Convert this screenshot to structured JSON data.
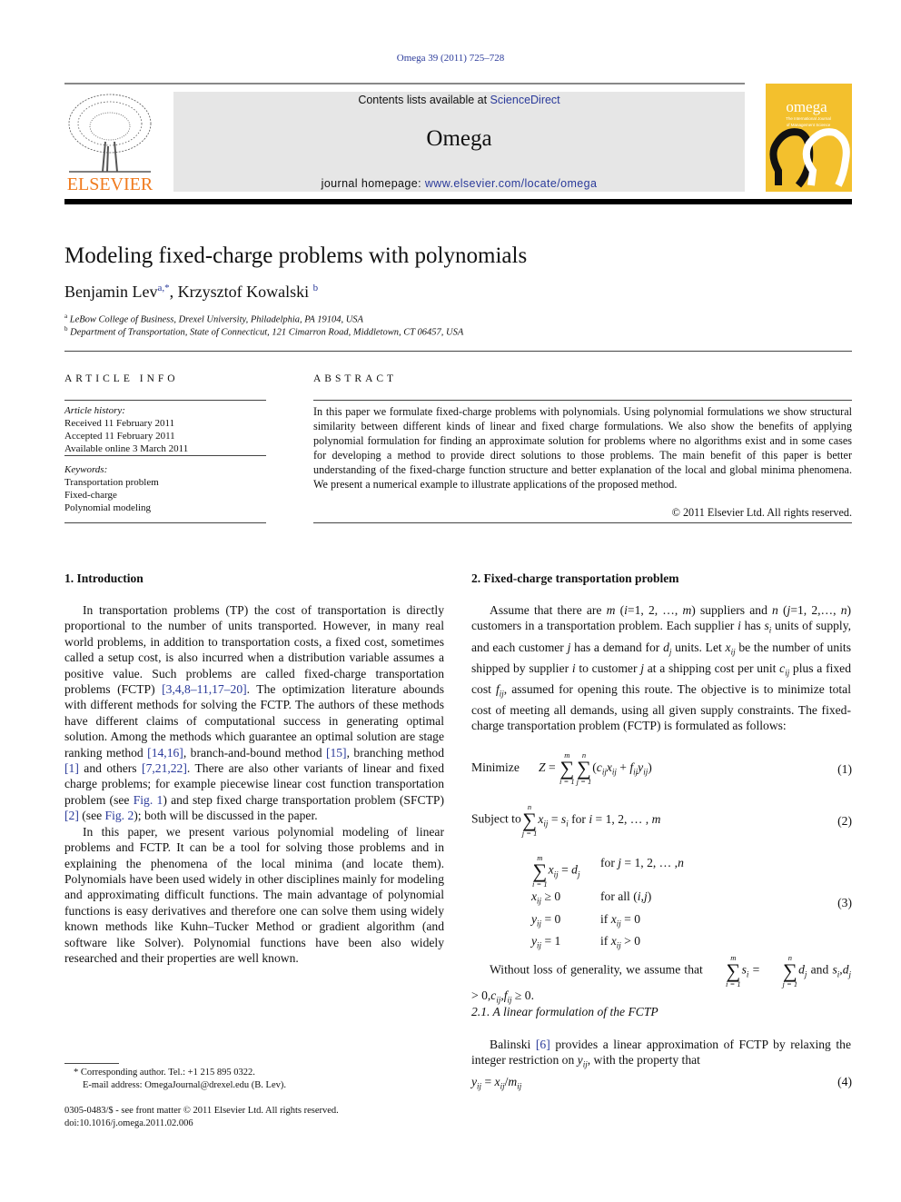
{
  "header": {
    "citation": "Omega 39 (2011) 725–728",
    "contents_prefix": "Contents lists available at ",
    "contents_link": "ScienceDirect",
    "journal": "Omega",
    "homepage_prefix": "journal homepage: ",
    "homepage_link": "www.elsevier.com/locate/omega",
    "publisher_logo": "ELSEVIER",
    "cover_title": "omega",
    "cover_subtitle": "The International Journal of Management Science",
    "colors": {
      "publisher": "#f07b1f",
      "cover": "#f3c02d",
      "link": "#2a3a9a"
    }
  },
  "article": {
    "title": "Modeling fixed-charge problems with polynomials",
    "authors": [
      {
        "name": "Benjamin Lev",
        "sup": "a,*"
      },
      {
        "name": "Krzysztof Kowalski",
        "sup": "b"
      }
    ],
    "affiliations": [
      {
        "sup": "a",
        "text": "LeBow College of Business, Drexel University, Philadelphia, PA 19104, USA"
      },
      {
        "sup": "b",
        "text": "Department of Transportation, State of Connecticut, 121 Cimarron Road, Middletown, CT 06457, USA"
      }
    ]
  },
  "info": {
    "heading": "ARTICLE INFO",
    "history_label": "Article history:",
    "history": [
      "Received 11 February 2011",
      "Accepted 11 February 2011",
      "Available online 3 March 2011"
    ],
    "keywords_label": "Keywords:",
    "keywords": [
      "Transportation problem",
      "Fixed-charge",
      "Polynomial modeling"
    ]
  },
  "abstract": {
    "heading": "ABSTRACT",
    "text": "In this paper we formulate fixed-charge problems with polynomials. Using polynomial formulations we show structural similarity between different kinds of linear and fixed charge formulations. We also show the benefits of applying polynomial formulation for finding an approximate solution for problems where no algorithms exist and in some cases for developing a method to provide direct solutions to those problems. The main benefit of this paper is better understanding of the fixed-charge function structure and better explanation of the local and global minima phenomena. We present a numerical example to illustrate applications of the proposed method.",
    "copyright": "© 2011 Elsevier Ltd. All rights reserved."
  },
  "left": {
    "heading": "1.  Introduction",
    "paragraphs": [
      [
        [
          "t",
          "In transportation problems (TP) the cost of transportation is directly proportional to the number of units transported. However, in many real world problems, in addition to transportation costs, a fixed cost, sometimes called a setup cost, is also incurred when a distribution variable assumes a positive value. Such problems are called fixed-charge transportation problems (FCTP) "
        ],
        [
          "l",
          "[3,4,8–11,17–20]"
        ],
        [
          "t",
          ". The optimization literature abounds with different methods for solving the FCTP. The authors of these methods have different claims of computational success in generating optimal solution. Among the methods which guarantee an optimal solution are stage ranking method "
        ],
        [
          "l",
          "[14,16]"
        ],
        [
          "t",
          ", branch-and-bound method "
        ],
        [
          "l",
          "[15]"
        ],
        [
          "t",
          ", branching method "
        ],
        [
          "l",
          "[1]"
        ],
        [
          "t",
          " and others "
        ],
        [
          "l",
          "[7,21,22]"
        ],
        [
          "t",
          ". There are also other variants of linear and fixed charge problems; for example piecewise linear cost function transportation problem (see "
        ],
        [
          "l",
          "Fig. 1"
        ],
        [
          "t",
          ") and step fixed charge transportation problem (SFCTP) "
        ],
        [
          "l",
          "[2]"
        ],
        [
          "t",
          " (see "
        ],
        [
          "l",
          "Fig. 2"
        ],
        [
          "t",
          "); both will be discussed in the paper."
        ]
      ],
      [
        [
          "t",
          "In this paper, we present various polynomial modeling of linear problems and FCTP. It can be a tool for solving those problems and in explaining the phenomena of the local minima (and locate them). Polynomials have been used widely in other disciplines mainly for modeling and approximating difficult functions. The main advantage of polynomial functions is easy derivatives and therefore one can solve them using widely known methods like Kuhn–Tucker Method or gradient algorithm (and software like Solver). Polynomial functions have been also widely researched and their properties are well known."
        ]
      ]
    ],
    "footnotes": [
      "* Corresponding author. Tel.: +1 215 895 0322.",
      "E-mail address: OmegaJournal@drexel.edu (B. Lev)."
    ],
    "front_matter": "0305-0483/$ - see front matter © 2011 Elsevier Ltd. All rights reserved.",
    "doi": "doi:10.1016/j.omega.2011.02.006"
  },
  "right": {
    "heading": "2.  Fixed-charge transportation problem",
    "p1": [
      [
        "t",
        "Assume that there are "
      ],
      [
        "i",
        "m"
      ],
      [
        "t",
        " ("
      ],
      [
        "i",
        "i"
      ],
      [
        "t",
        "=1, 2, …, "
      ],
      [
        "i",
        "m"
      ],
      [
        "t",
        ") suppliers and "
      ],
      [
        "i",
        "n"
      ],
      [
        "t",
        " ("
      ],
      [
        "i",
        "j"
      ],
      [
        "t",
        "=1, 2,…, "
      ],
      [
        "i",
        "n"
      ],
      [
        "t",
        ") customers in a transportation problem. Each supplier "
      ],
      [
        "i",
        "i"
      ],
      [
        "t",
        " has "
      ],
      [
        "i",
        "s"
      ],
      [
        "s",
        "i"
      ],
      [
        "t",
        " units of supply, and each customer "
      ],
      [
        "i",
        "j"
      ],
      [
        "t",
        " has a demand for "
      ],
      [
        "i",
        "d"
      ],
      [
        "s",
        "j"
      ],
      [
        "t",
        " units. Let "
      ],
      [
        "i",
        "x"
      ],
      [
        "s",
        "ij"
      ],
      [
        "t",
        " be the number of units shipped by supplier "
      ],
      [
        "i",
        "i"
      ],
      [
        "t",
        " to customer "
      ],
      [
        "i",
        "j"
      ],
      [
        "t",
        " at a shipping cost per unit "
      ],
      [
        "i",
        "c"
      ],
      [
        "s",
        "ij"
      ],
      [
        "t",
        " plus a fixed cost "
      ],
      [
        "i",
        "f"
      ],
      [
        "s",
        "ij"
      ],
      [
        "t",
        ", assumed for opening this route. The objective is to minimize total cost of meeting all demands, using all given supply constraints. The fixed-charge transportation problem (FCTP) is formulated as follows:"
      ]
    ],
    "eq1": {
      "label": "Minimize",
      "expr": [
        [
          "i",
          "Z"
        ],
        [
          "t",
          " = "
        ],
        [
          "sum",
          "m",
          "i = 1"
        ],
        [
          "sum",
          "n",
          "j = 1"
        ],
        [
          "t",
          "("
        ],
        [
          "i",
          "c"
        ],
        [
          "s",
          "ij"
        ],
        [
          "i",
          "x"
        ],
        [
          "s",
          "ij"
        ],
        [
          "t",
          " + "
        ],
        [
          "i",
          "f"
        ],
        [
          "s",
          "ij"
        ],
        [
          "i",
          "y"
        ],
        [
          "s",
          "ij"
        ],
        [
          "t",
          ")"
        ]
      ],
      "num": "(1)"
    },
    "eq2": {
      "label": "Subject to",
      "expr": [
        [
          "sum",
          "n",
          "j = 1"
        ],
        [
          "i",
          "x"
        ],
        [
          "s",
          "ij"
        ],
        [
          "t",
          " = "
        ],
        [
          "i",
          "s"
        ],
        [
          "s",
          "i"
        ],
        [
          "t",
          "  for "
        ],
        [
          "i",
          "i"
        ],
        [
          "t",
          " = 1, 2, … , "
        ],
        [
          "i",
          "m"
        ]
      ],
      "num": "(2)"
    },
    "eq3": {
      "rows": [
        {
          "a": [
            [
              "sum",
              "m",
              "i = 1"
            ],
            [
              "i",
              "x"
            ],
            [
              "s",
              "ij"
            ],
            [
              "t",
              " = "
            ],
            [
              "i",
              "d"
            ],
            [
              "s",
              "j"
            ]
          ],
          "b": [
            [
              "t",
              "for "
            ],
            [
              "i",
              "j"
            ],
            [
              "t",
              " = 1, 2, … ,"
            ],
            [
              "i",
              "n"
            ]
          ]
        },
        {
          "a": [
            [
              "i",
              "x"
            ],
            [
              "s",
              "ij"
            ],
            [
              "t",
              " ≥ 0"
            ]
          ],
          "b": [
            [
              "t",
              "for all ("
            ],
            [
              "i",
              "i,j"
            ],
            [
              "t",
              ")"
            ]
          ]
        },
        {
          "a": [
            [
              "i",
              "y"
            ],
            [
              "s",
              "ij"
            ],
            [
              "t",
              " = 0"
            ]
          ],
          "b": [
            [
              "t",
              "if "
            ],
            [
              "i",
              "x"
            ],
            [
              "s",
              "ij"
            ],
            [
              "t",
              " = 0"
            ]
          ]
        },
        {
          "a": [
            [
              "i",
              "y"
            ],
            [
              "s",
              "ij"
            ],
            [
              "t",
              " = 1"
            ]
          ],
          "b": [
            [
              "t",
              "if "
            ],
            [
              "i",
              "x"
            ],
            [
              "s",
              "ij"
            ],
            [
              "t",
              " > 0"
            ]
          ]
        }
      ],
      "num": "(3)"
    },
    "p2": [
      [
        "t",
        "Without loss of generality, we assume that "
      ],
      [
        "sum",
        "m",
        "i = 1"
      ],
      [
        "i",
        "s"
      ],
      [
        "s",
        "i"
      ],
      [
        "t",
        " = "
      ],
      [
        "sum",
        "n",
        "j = 1"
      ],
      [
        "i",
        "d"
      ],
      [
        "s",
        "j"
      ],
      [
        "t",
        " and "
      ],
      [
        "i",
        "s"
      ],
      [
        "s",
        "i"
      ],
      [
        "t",
        ","
      ],
      [
        "i",
        "d"
      ],
      [
        "s",
        "j"
      ],
      [
        "t",
        " > 0,"
      ],
      [
        "i",
        "c"
      ],
      [
        "s",
        "ij"
      ],
      [
        "t",
        ","
      ],
      [
        "i",
        "f"
      ],
      [
        "s",
        "ij"
      ],
      [
        "t",
        " ≥ 0."
      ]
    ],
    "subheading": "2.1.  A linear formulation of the FCTP",
    "p3": [
      [
        "t",
        "Balinski "
      ],
      [
        "l",
        "[6]"
      ],
      [
        "t",
        " provides a linear approximation of FCTP by relaxing the integer restriction on "
      ],
      [
        "i",
        "y"
      ],
      [
        "s",
        "ij"
      ],
      [
        "t",
        ", with the property that"
      ]
    ],
    "eq4": {
      "expr": [
        [
          "i",
          "y"
        ],
        [
          "s",
          "ij"
        ],
        [
          "t",
          " = "
        ],
        [
          "i",
          "x"
        ],
        [
          "s",
          "ij"
        ],
        [
          "t",
          "/"
        ],
        [
          "i",
          "m"
        ],
        [
          "s",
          "ij"
        ]
      ],
      "num": "(4)"
    }
  }
}
